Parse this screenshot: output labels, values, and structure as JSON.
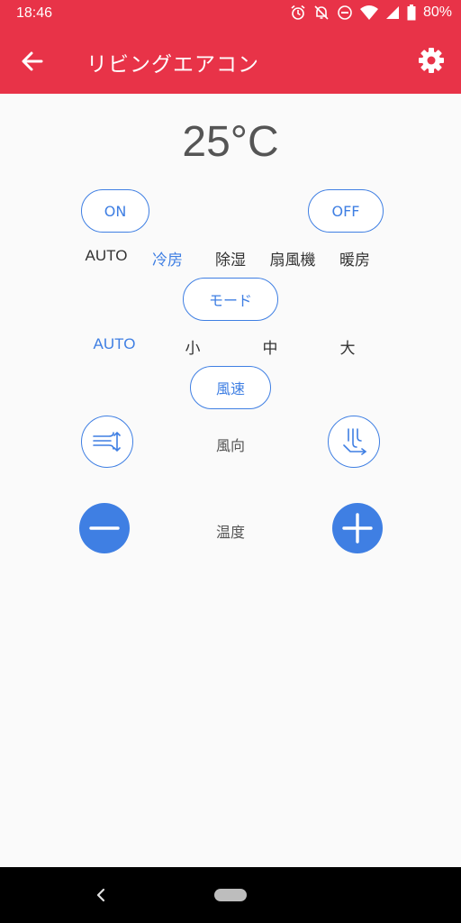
{
  "status_bar": {
    "time": "18:46",
    "battery": "80%"
  },
  "app_bar": {
    "title": "リビングエアコン"
  },
  "temperature": {
    "display": "25°C"
  },
  "power": {
    "on_label": "ON",
    "off_label": "OFF"
  },
  "mode": {
    "options": [
      "AUTO",
      "冷房",
      "除湿",
      "扇風機",
      "暖房"
    ],
    "selected": "冷房",
    "button_label": "モード"
  },
  "fan_speed": {
    "options": [
      "AUTO",
      "小",
      "中",
      "大"
    ],
    "selected": "AUTO",
    "button_label": "風速"
  },
  "wind_direction": {
    "label": "風向"
  },
  "temp_control": {
    "label": "温度"
  },
  "colors": {
    "accent": "#e83348",
    "primary": "#3f7fe3"
  }
}
